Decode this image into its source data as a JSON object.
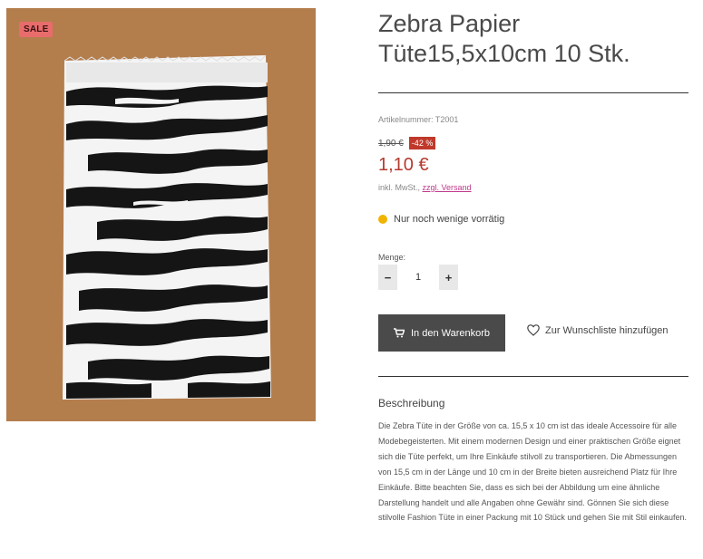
{
  "product": {
    "badge": "SALE",
    "title": "Zebra Papier Tüte15,5x10cm 10 Stk.",
    "sku": "Artikelnummer: T2001",
    "old_price": "1,90 €",
    "discount": "-42 %",
    "price": "1,10 €",
    "tax_text": "inkl. MwSt.,",
    "shipping_link": "zzgl. Versand",
    "stock_status": "Nur noch wenige vorrätig",
    "stock_color": "#f0b400",
    "quantity_label": "Menge:",
    "quantity_value": "1",
    "minus_label": "−",
    "plus_label": "+",
    "add_to_cart": "In den Warenkorb",
    "wishlist": "Zur Wunschliste hinzufügen",
    "description_title": "Beschreibung",
    "description": "Die Zebra Tüte in der Größe von ca. 15,5 x 10 cm ist das ideale Accessoire für alle Modebegeisterten. Mit einem modernen Design und einer praktischen Größe eignet sich die Tüte perfekt, um Ihre Einkäufe stilvoll zu transportieren. Die Abmessungen von 15,5 cm in der Länge und 10 cm in der Breite bieten ausreichend Platz für Ihre Einkäufe. Bitte beachten Sie, dass es sich bei der Abbildung um eine ähnliche Darstellung handelt und alle Angaben ohne Gewähr sind. Gönnen Sie sich diese stilvolle Fashion Tüte in einer Packung mit 10 Stück und gehen Sie mit Stil einkaufen."
  },
  "colors": {
    "price": "#b53a2e",
    "discount_badge": "#c0392b",
    "sale_badge": "#e86c6c",
    "cart_button": "#4a4a4a",
    "link": "#c0398b"
  },
  "icons": {
    "cart": "cart-icon",
    "wishlist": "heart-icon"
  }
}
